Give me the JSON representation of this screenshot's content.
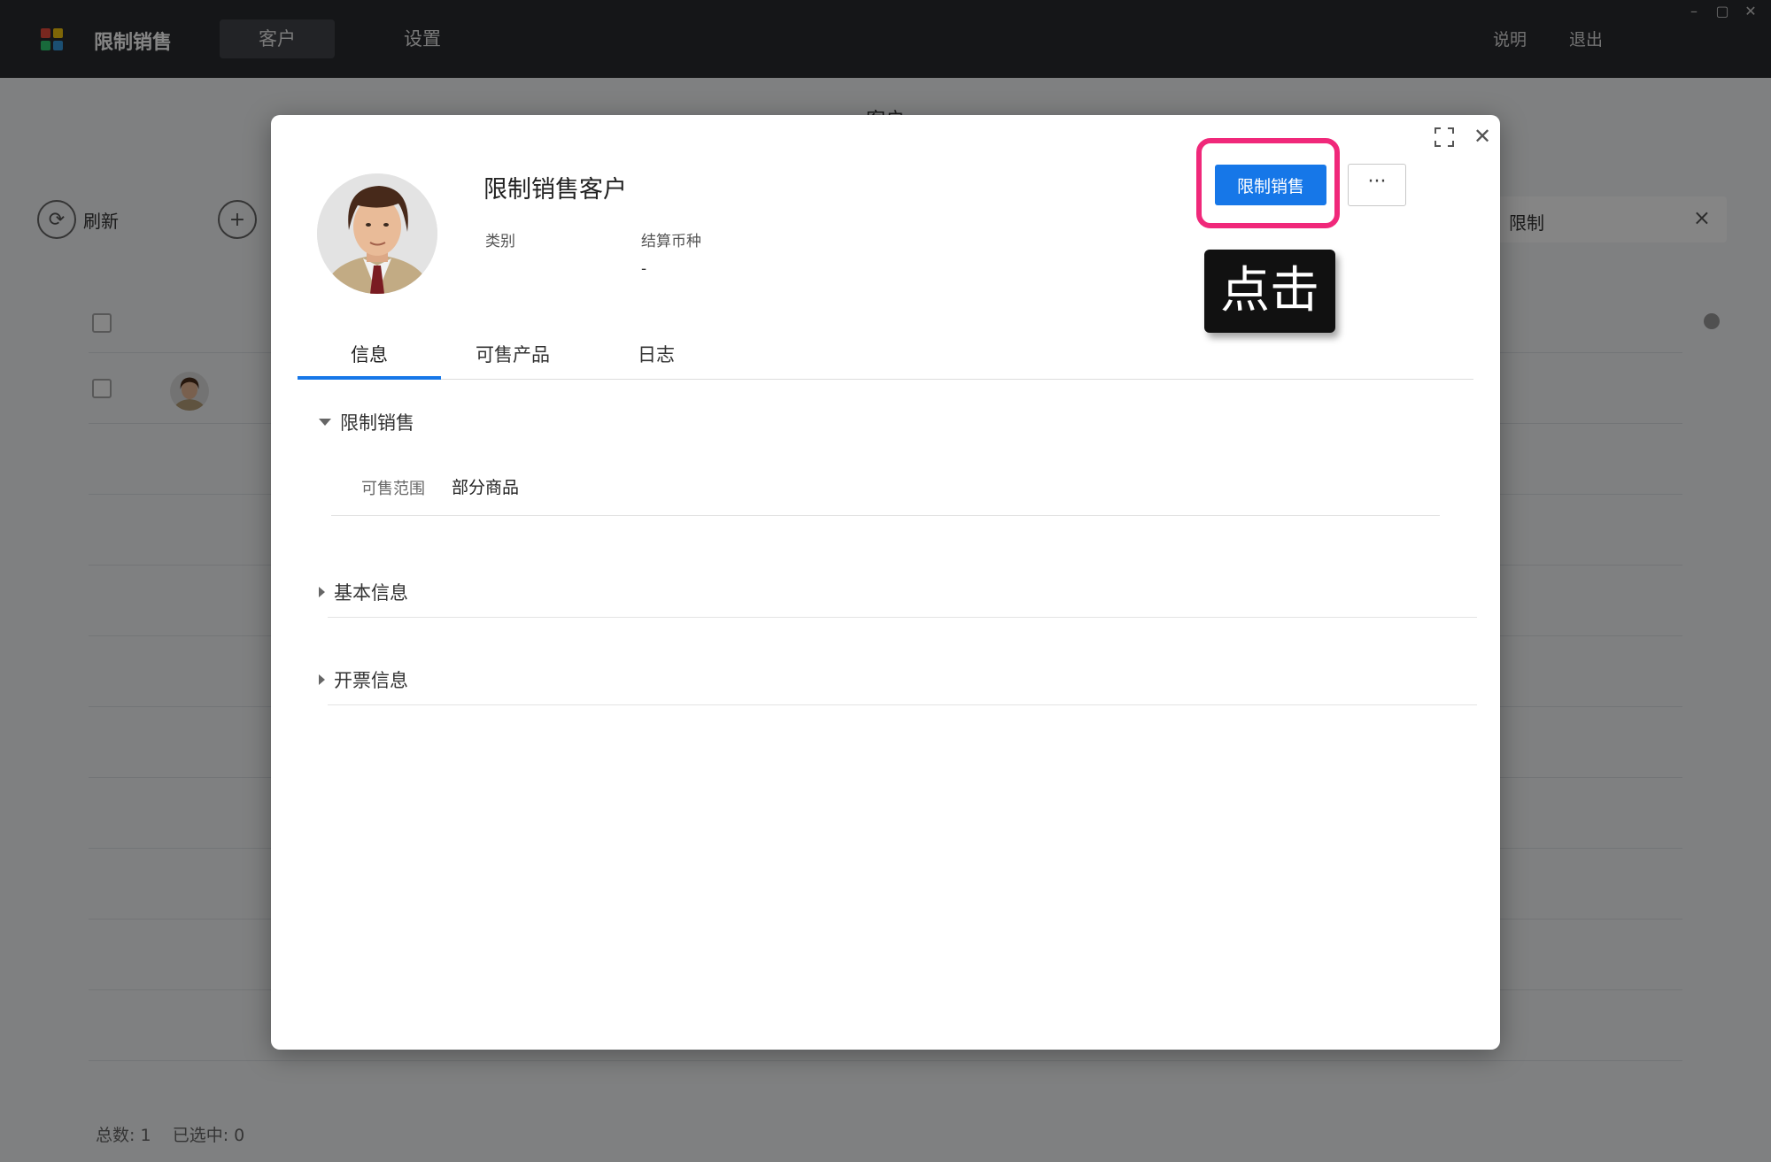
{
  "app": {
    "title": "限制销售",
    "nav": [
      "客户",
      "设置"
    ],
    "top_links": [
      "说明",
      "退出"
    ],
    "page_title": "客户",
    "toolbar": {
      "refresh": "刷新",
      "search_text": "限制"
    },
    "footer": {
      "total_label": "总数:",
      "total": "1",
      "selected_label": "已选中:",
      "selected": "0"
    }
  },
  "modal": {
    "customer_name": "限制销售客户",
    "meta": [
      {
        "label": "类别",
        "value": ""
      },
      {
        "label": "结算币种",
        "value": "-"
      }
    ],
    "primary_button": "限制销售",
    "more_button": "···",
    "tooltip": "点击",
    "tabs": [
      "信息",
      "可售产品",
      "日志"
    ],
    "active_tab": 0,
    "sections": {
      "restrict": {
        "title": "限制销售",
        "field_label": "可售范围",
        "field_value": "部分商品"
      },
      "basic": {
        "title": "基本信息"
      },
      "invoice": {
        "title": "开票信息"
      }
    }
  },
  "colors": {
    "accent": "#1677e8",
    "highlight": "#f0287a",
    "topbar": "#2a2b2e"
  }
}
